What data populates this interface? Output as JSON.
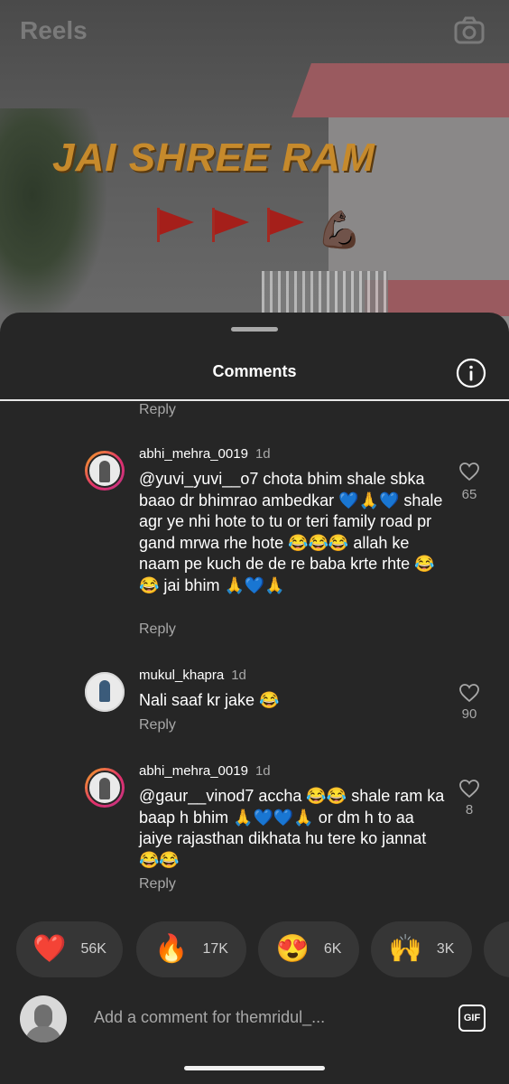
{
  "header": {
    "title": "Reels",
    "camera_icon": "camera-icon"
  },
  "reel": {
    "overlay_text": "JAI SHREE RAM",
    "flags_count": 3,
    "emoji": "💪🏿"
  },
  "sheet": {
    "title": "Comments",
    "info_icon": "info-icon",
    "top_reply": "Reply"
  },
  "comments": [
    {
      "username": "abhi_mehra_0019",
      "time": "1d",
      "text": "@yuvi_yuvi__o7 chota bhim shale sbka baao dr bhimrao ambedkar 💙🙏💙 shale agr ye nhi hote to tu or teri family road pr gand mrwa rhe hote 😂😂😂 allah ke naam pe kuch de de re baba krte rhte 😂😂 jai bhim 🙏💙🙏",
      "likes": "65",
      "reply": "Reply"
    },
    {
      "username": "mukul_khapra",
      "time": "1d",
      "text": "Nali saaf kr jake 😂",
      "likes": "90",
      "reply": "Reply"
    },
    {
      "username": "abhi_mehra_0019",
      "time": "1d",
      "text": "@gaur__vinod7 accha 😂😂 shale ram ka baap h bhim 🙏💙💙🙏 or dm h to aa jaiye rajasthan dikhata hu tere ko jannat 😂😂",
      "likes": "8",
      "reply": "Reply"
    }
  ],
  "reactions": [
    {
      "emoji": "❤️",
      "count": "56K"
    },
    {
      "emoji": "🔥",
      "count": "17K"
    },
    {
      "emoji": "😍",
      "count": "6K"
    },
    {
      "emoji": "🙌",
      "count": "3K"
    }
  ],
  "composer": {
    "placeholder": "Add a comment for themridul_...",
    "gif_label": "GIF"
  },
  "colors": {
    "sheet_bg": "#262626",
    "secondary_text": "#a8a8a8",
    "story_ring": "#e1306c"
  }
}
